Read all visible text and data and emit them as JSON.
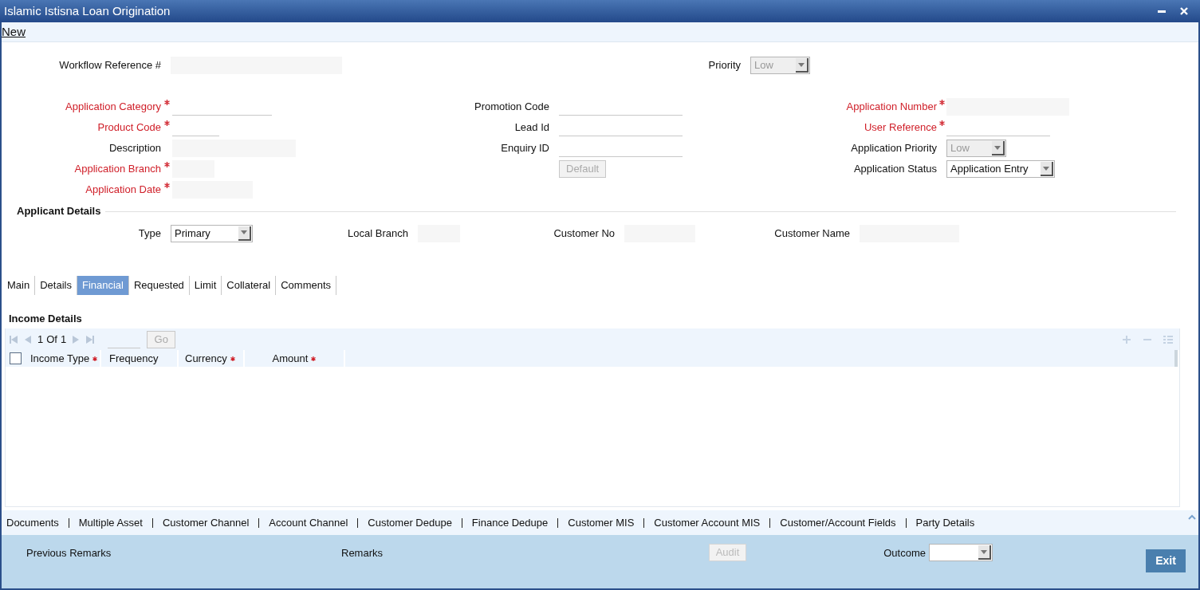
{
  "window": {
    "title": "Islamic Istisna Loan Origination"
  },
  "toolbar": {
    "new_link": "New"
  },
  "workflow": {
    "reference": {
      "label": "Workflow Reference #",
      "required": false,
      "kind": "input",
      "readonly": true
    },
    "priority": {
      "label": "Priority",
      "required": false,
      "kind": "select",
      "value": "Low",
      "disabled": true
    }
  },
  "fields": [
    [
      {
        "label": "Application Category",
        "required": true,
        "kind": "input",
        "readonly": false
      },
      {
        "label": "Product Code",
        "required": true,
        "kind": "input",
        "readonly": false
      },
      {
        "label": "Description",
        "required": false,
        "kind": "input",
        "readonly": true
      },
      {
        "label": "Application Branch",
        "required": true,
        "kind": "input",
        "readonly": true
      },
      {
        "label": "Application Date",
        "required": true,
        "kind": "input",
        "readonly": true
      }
    ],
    [
      {
        "label": "Promotion Code",
        "required": false,
        "kind": "input",
        "readonly": false
      },
      {
        "label": "Lead Id",
        "required": false,
        "kind": "input",
        "readonly": false
      },
      {
        "label": "Enquiry ID",
        "required": false,
        "kind": "input",
        "readonly": false
      },
      {
        "kind": "button",
        "text": "Default",
        "disabled": true
      }
    ],
    [
      {
        "label": "Application Number",
        "required": true,
        "kind": "input",
        "readonly": true
      },
      {
        "label": "User Reference",
        "required": true,
        "kind": "input",
        "readonly": false
      },
      {
        "label": "Application Priority",
        "required": false,
        "kind": "select",
        "value": "Low",
        "disabled": true
      },
      {
        "label": "Application Status",
        "required": false,
        "kind": "select",
        "value": "Application Entry",
        "disabled": false
      }
    ]
  ],
  "applicant_details": {
    "title": "Applicant Details",
    "fields": [
      {
        "label": "Type",
        "required": false,
        "kind": "select",
        "value": "Primary",
        "disabled": false
      },
      {
        "label": "Local Branch",
        "required": false,
        "kind": "input",
        "readonly": true
      },
      {
        "label": "Customer No",
        "required": false,
        "kind": "input",
        "readonly": true
      },
      {
        "label": "Customer Name",
        "required": false,
        "kind": "input",
        "readonly": true
      }
    ]
  },
  "tabs": [
    {
      "label": "Main",
      "selected": false
    },
    {
      "label": "Details",
      "selected": false
    },
    {
      "label": "Financial",
      "selected": true
    },
    {
      "label": "Requested",
      "selected": false
    },
    {
      "label": "Limit",
      "selected": false
    },
    {
      "label": "Collateral",
      "selected": false
    },
    {
      "label": "Comments",
      "selected": false
    }
  ],
  "income_details": {
    "title": "Income Details",
    "pager": {
      "page": "1",
      "of_label": "Of",
      "total": "1",
      "go": "Go"
    },
    "select_all": {
      "checked": false
    },
    "columns": [
      {
        "label": "Income Type",
        "required": true
      },
      {
        "label": "Frequency",
        "required": false
      },
      {
        "label": "Currency",
        "required": true
      },
      {
        "label": "Amount",
        "required": true
      }
    ]
  },
  "bottom_links": [
    "Documents",
    "Multiple Asset",
    "Customer Channel",
    "Account Channel",
    "Customer Dedupe",
    "Finance Dedupe",
    "Customer MIS",
    "Customer Account MIS",
    "Customer/Account Fields",
    "Party Details"
  ],
  "footer": {
    "previous_remarks": "Previous Remarks",
    "remarks": "Remarks",
    "audit": {
      "text": "Audit",
      "disabled": true
    },
    "outcome": {
      "label": "Outcome",
      "kind": "select",
      "disabled": false
    },
    "exit": "Exit"
  }
}
